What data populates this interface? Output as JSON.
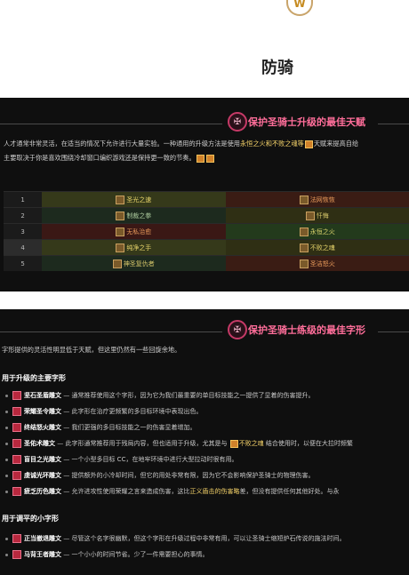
{
  "page": {
    "title": "防骑",
    "logo_icon": "shield-emblem-icon"
  },
  "talents_section": {
    "title": "保护圣骑士升级的最佳天赋",
    "intro_line1_a": "人才通常非常灵活，在适当的情况下允许进行大量实验。一种通用的升级方法是使用",
    "intro_line1_hl": "永恒之火和不败之魂等",
    "intro_line1_b": "天赋来提高自给",
    "intro_line2": "主要取决于你是喜欢围绕冷却窗口编织游戏还是保持更一致的节奏。",
    "rows": [
      {
        "level": "1",
        "left": "圣光之速",
        "right": "法网恢恢"
      },
      {
        "level": "2",
        "left": "制裁之拳",
        "right": "忏悔"
      },
      {
        "level": "3",
        "left": "无私治愈",
        "right": "永恒之火"
      },
      {
        "level": "4",
        "left": "纯净之手",
        "right": "不败之魂"
      },
      {
        "level": "5",
        "left": "神圣复仇者",
        "right": "圣洁怒火"
      }
    ]
  },
  "glyphs_section": {
    "title": "保护圣骑士练级的最佳字形",
    "intro": "字形提供的灵活性明显低于天赋，但这里仍然有一些回旋余地。",
    "major_heading": "用于升级的主要字形",
    "major": [
      {
        "name": "坚石圣盾雕文",
        "desc": " — 通常推荐使用这个字形，因为它为我们最重要的单目标技能之一提供了显着的伤害提升。"
      },
      {
        "name": "荣耀圣令雕文",
        "desc": " — 此字形在治疗更频繁的多目标环境中表现出色。"
      },
      {
        "name": "终结怒火雕文",
        "desc": " — 我们更强的多目标技能之一的伤害显着增加。"
      },
      {
        "name": "圣佑术雕文",
        "desc": " — 此字形通常推荐用于残局内容，但也适用于升级，尤其是与 ",
        "hl": "不败之魂",
        "desc2": " 结合使用时，以便在大拉时频繁"
      },
      {
        "name": "盲目之光雕文",
        "desc": " — 一个小型多目标 CC，在地牢环境中进行大型拉动时很有用。"
      },
      {
        "name": "虔诚光环雕文",
        "desc": " — 提供额外的小冷却时间，但它的用处非常有限，因为它不会影响保护圣骑士的物理伤害。"
      },
      {
        "name": "疲乏历色雕文",
        "desc": " — 允许进攻性使用荣耀之言来造成伤害，这比",
        "hl": "正义盾击的伤害略",
        "desc2": "差，但没有提供任何其他好处。与永"
      }
    ],
    "minor_heading": "用于调平的小字形",
    "minor": [
      {
        "name": "正当撤退雕文",
        "desc": " — 尽管这个名字很幽默，但这个字形在升级过程中非常有用，可以让圣骑士缩短炉石传说的施法时间。"
      },
      {
        "name": "马背王者雕文",
        "desc": " — 一个小小的时间节省。少了一件需要担心的事情。"
      }
    ]
  },
  "colors": {
    "accent_pink": "#ff6e9a",
    "highlight_gold": "#f7d46a",
    "panel_bg": "#0f0f0f"
  }
}
